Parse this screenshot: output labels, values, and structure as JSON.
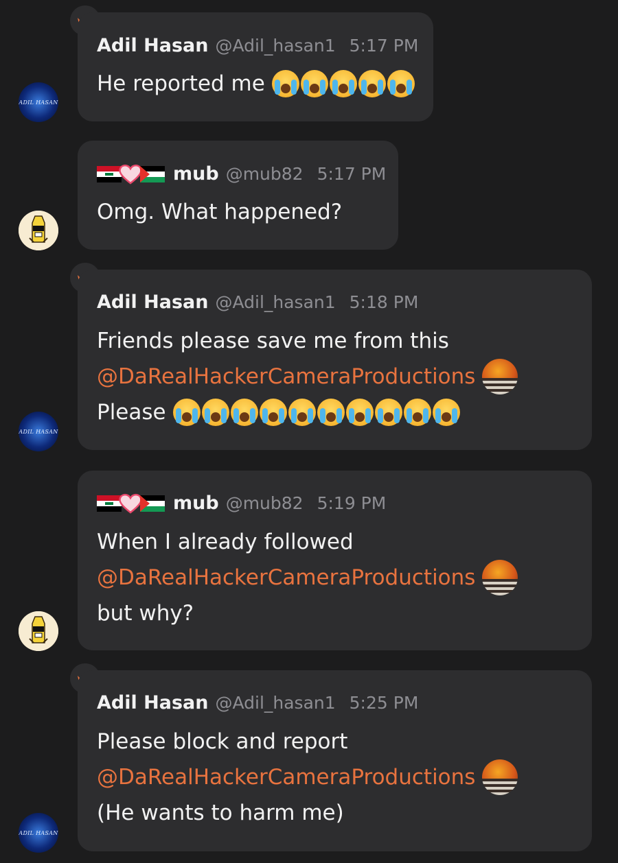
{
  "messages": [
    {
      "author": "Adil Hasan",
      "handle": "@Adil_hasan1",
      "time": "5:17 PM",
      "lines": [
        {
          "text": "He reported me",
          "mention": "",
          "emoji": [
            "crying-face",
            "crying-face",
            "crying-face",
            "crying-face",
            "crying-face"
          ]
        }
      ]
    },
    {
      "author": "mub",
      "handle": "@mub82",
      "time": "5:17 PM",
      "lines": [
        {
          "text": "Omg. What happened?",
          "mention": "",
          "emoji": []
        }
      ]
    },
    {
      "author": "Adil Hasan",
      "handle": "@Adil_hasan1",
      "time": "5:18 PM",
      "lines": [
        {
          "text": "Friends please save me from this",
          "mention": "",
          "emoji": []
        },
        {
          "text": "",
          "mention": "@DaRealHackerCameraProductions",
          "emoji": []
        },
        {
          "text": "Please",
          "mention": "",
          "emoji": [
            "crying-face",
            "crying-face",
            "crying-face",
            "crying-face",
            "crying-face",
            "crying-face",
            "crying-face",
            "crying-face",
            "crying-face",
            "crying-face"
          ]
        }
      ]
    },
    {
      "author": "mub",
      "handle": "@mub82",
      "time": "5:19 PM",
      "lines": [
        {
          "text": "When I already followed",
          "mention": "",
          "emoji": []
        },
        {
          "text": "",
          "mention": "@DaRealHackerCameraProductions",
          "emoji": []
        },
        {
          "text": "but why?",
          "mention": "",
          "emoji": []
        }
      ]
    },
    {
      "author": "Adil Hasan",
      "handle": "@Adil_hasan1",
      "time": "5:25 PM",
      "lines": [
        {
          "text": "Please block and report",
          "mention": "",
          "emoji": []
        },
        {
          "text": "",
          "mention": "@DaRealHackerCameraProductions",
          "emoji": []
        },
        {
          "text": "(He wants to harm me)",
          "mention": "",
          "emoji": []
        }
      ]
    }
  ],
  "avatar_adil_text": "ADIL HASAN",
  "colors": {
    "background": "#1c1c1d",
    "bubble": "#2d2d2f",
    "mention": "#e8733f",
    "crown": "#e8733f",
    "meta": "#8e8e93"
  },
  "icons": {
    "crown": "crown-icon",
    "mub_flags": [
      "iraq-flag-icon",
      "heart-icon",
      "palestine-flag-icon"
    ]
  }
}
